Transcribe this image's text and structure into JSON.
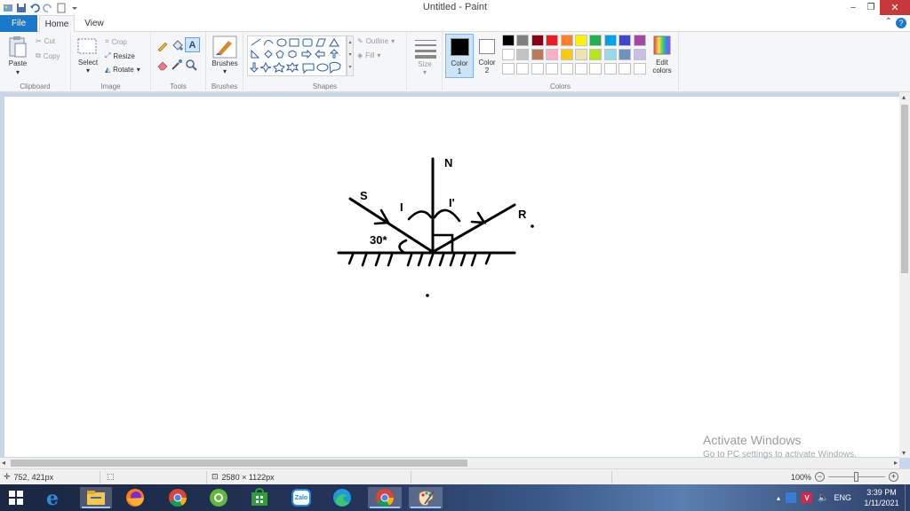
{
  "window": {
    "title": "Untitled - Paint",
    "minimize": "‒",
    "restore": "❐",
    "close": "✕"
  },
  "tabs": {
    "file": "File",
    "home": "Home",
    "view": "View",
    "help": "?"
  },
  "ribbon": {
    "clipboard": {
      "paste": "Paste",
      "cut": "Cut",
      "copy": "Copy",
      "label": "Clipboard"
    },
    "image": {
      "select": "Select",
      "crop": "Crop",
      "resize": "Resize",
      "rotate": "Rotate",
      "label": "Image"
    },
    "tools": {
      "label": "Tools"
    },
    "brushes": {
      "label": "Brushes"
    },
    "shapes": {
      "outline": "Outline",
      "fill": "Fill",
      "label": "Shapes"
    },
    "size": {
      "label": "Size"
    },
    "colors": {
      "color1": "Color",
      "color1_num": "1",
      "color2": "Color",
      "color2_num": "2",
      "edit_colors_1": "Edit",
      "edit_colors_2": "colors",
      "label": "Colors",
      "color1_value": "#000000",
      "color2_value": "#ffffff",
      "palette_row1": [
        "#000000",
        "#7f7f7f",
        "#880015",
        "#ed1c24",
        "#ff7f27",
        "#fff200",
        "#22b14c",
        "#00a2e8",
        "#3f48cc",
        "#a349a4"
      ],
      "palette_row2": [
        "#ffffff",
        "#c3c3c3",
        "#b97a57",
        "#ffaec9",
        "#ffc90e",
        "#efe4b0",
        "#b5e61d",
        "#99d9ea",
        "#7092be",
        "#c8bfe7"
      ]
    }
  },
  "drawing": {
    "label_n": "N",
    "label_s": "S",
    "label_r": "R",
    "label_i": "I",
    "label_ir": "I'",
    "label_angle": "30*"
  },
  "watermark": {
    "line1": "Activate Windows",
    "line2": "Go to PC settings to activate Windows."
  },
  "status": {
    "cursor_pos": "752, 421px",
    "canvas_size": "2580 × 1122px",
    "zoom": "100%"
  },
  "taskbar": {
    "lang": "ENG",
    "time": "3:39 PM",
    "date": "1/11/2021",
    "zalo": "Zalo"
  }
}
